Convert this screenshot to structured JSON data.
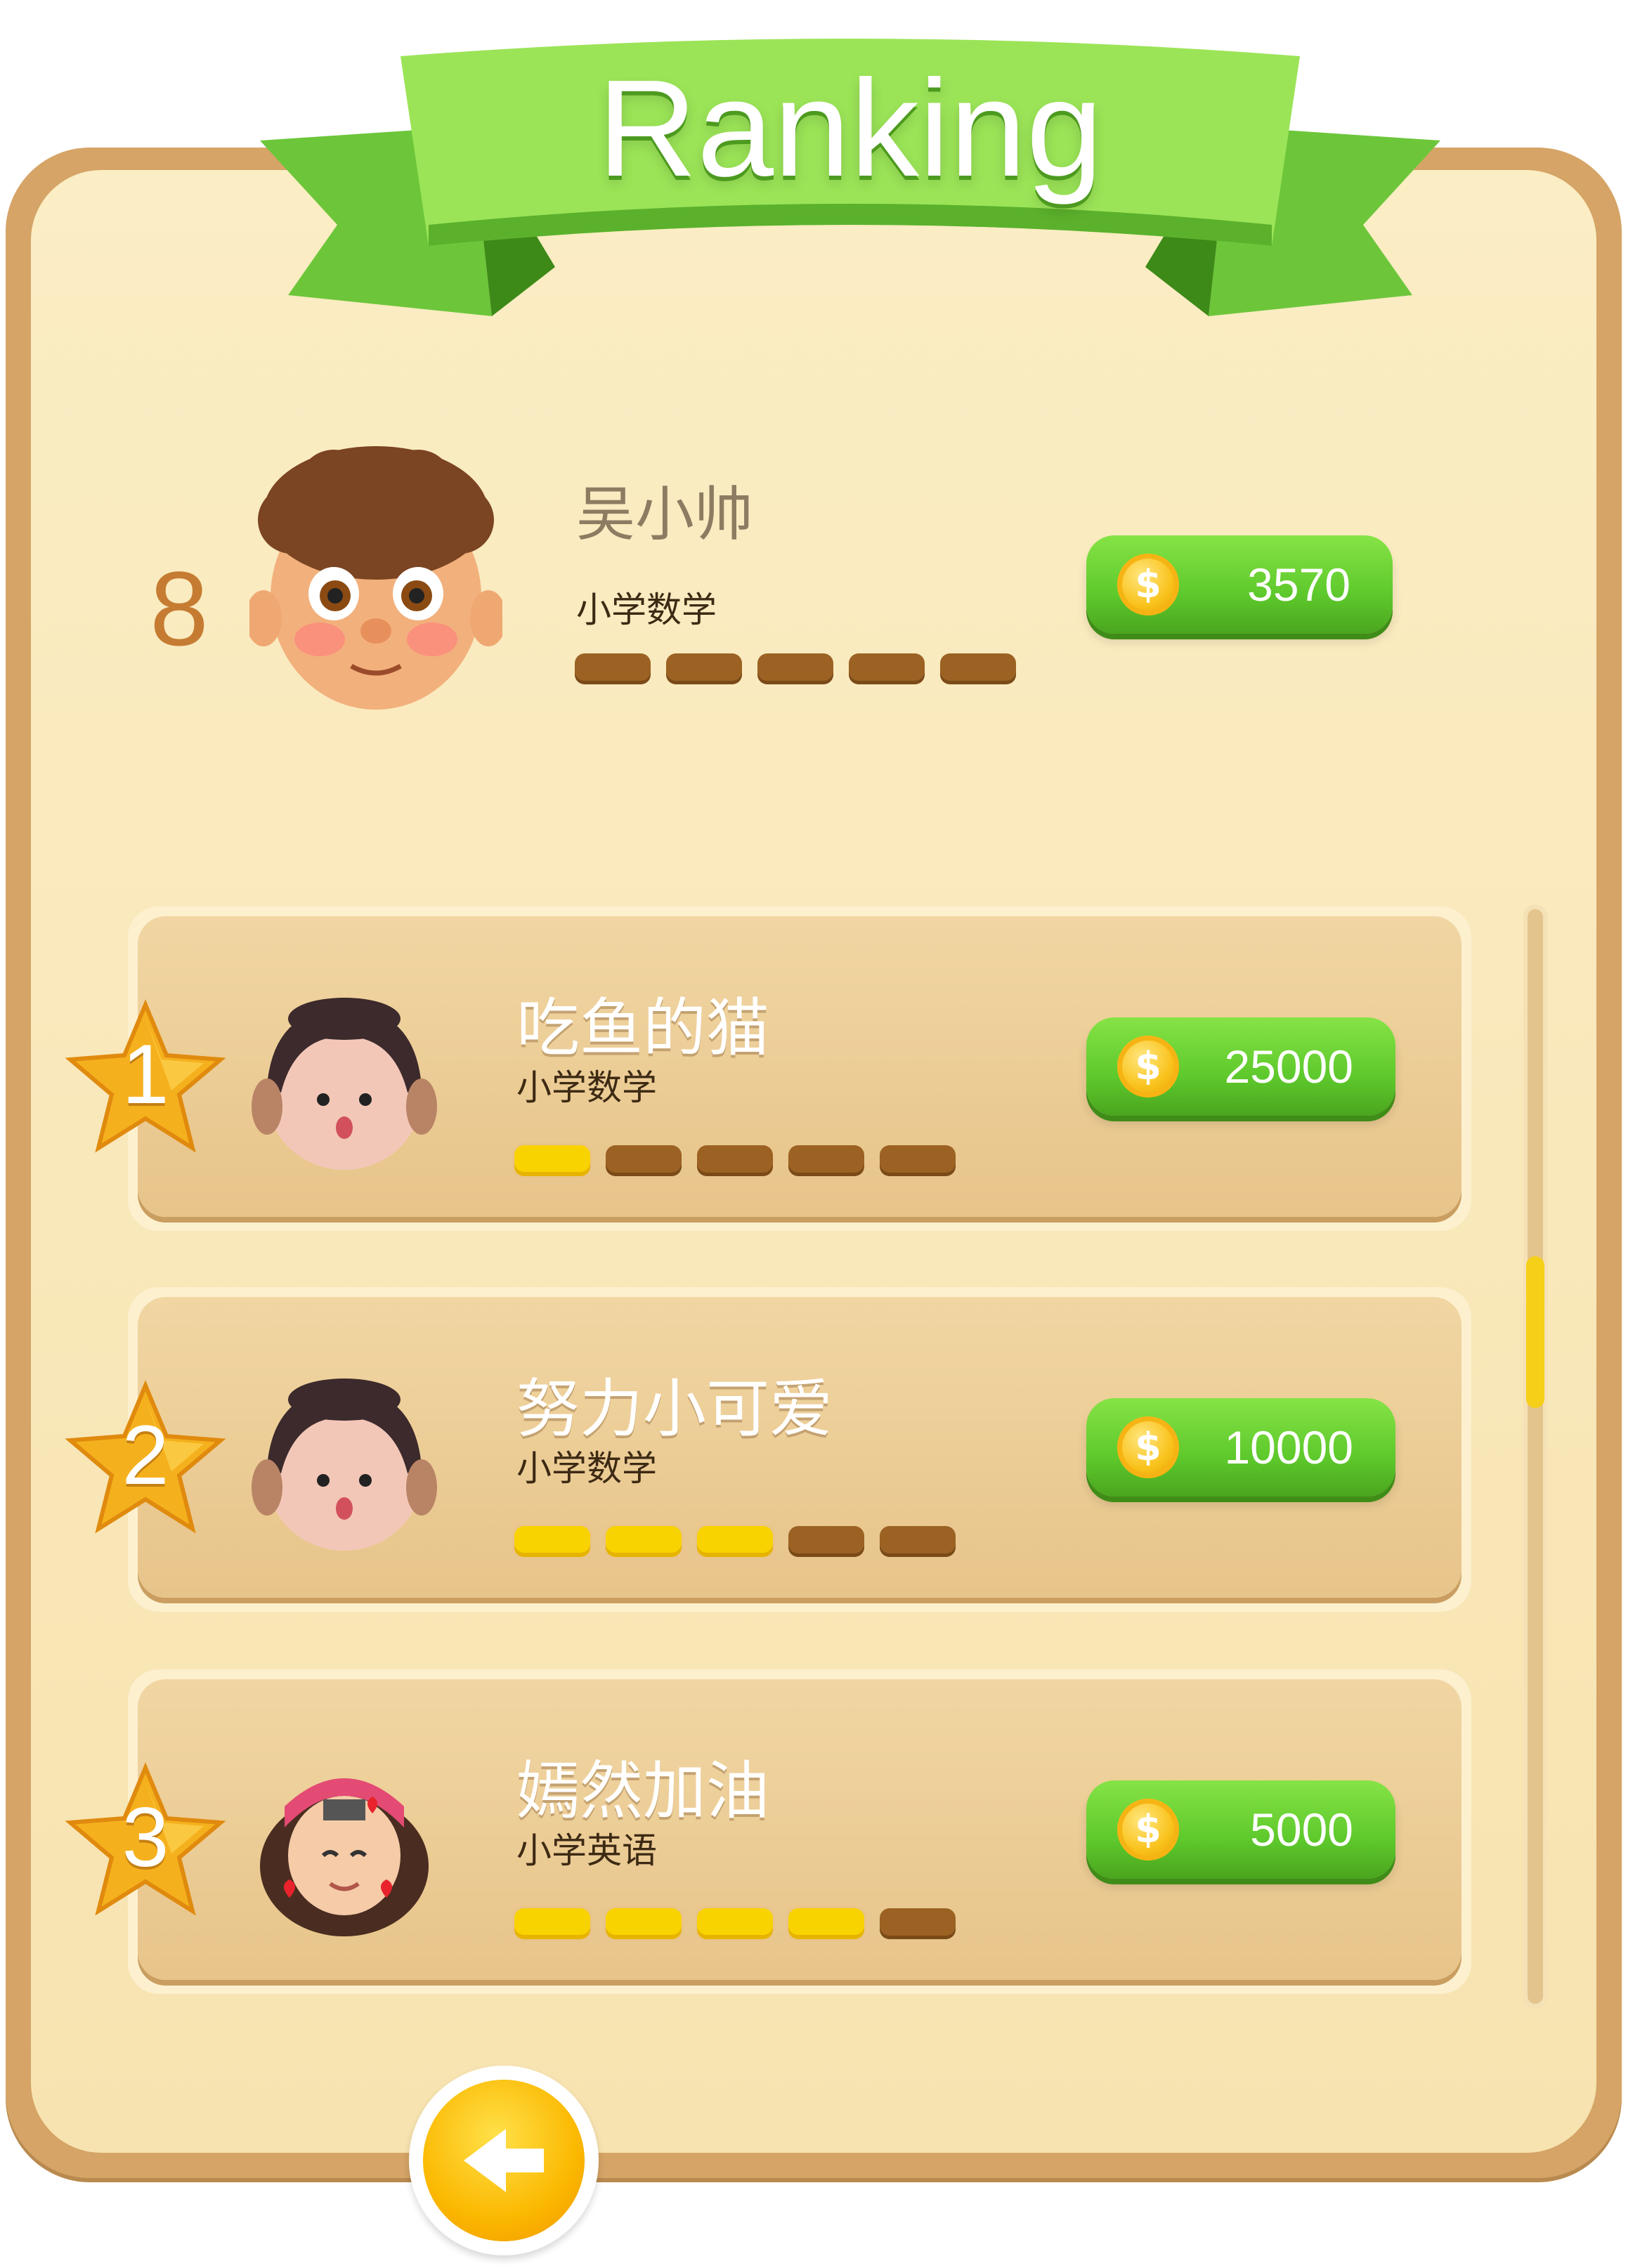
{
  "title": "Ranking",
  "me": {
    "rank": "8",
    "name": "吴小帅",
    "subject": "小学数学",
    "coins": "3570",
    "progress": 0
  },
  "list": [
    {
      "rank": "1",
      "name": "吃鱼的猫",
      "subject": "小学数学",
      "coins": "25000",
      "progress": 1
    },
    {
      "rank": "2",
      "name": "努力小可爱",
      "subject": "小学数学",
      "coins": "10000",
      "progress": 3
    },
    {
      "rank": "3",
      "name": "嫣然加油",
      "subject": "小学英语",
      "coins": "5000",
      "progress": 4
    }
  ],
  "progress_total": 5,
  "coin_symbol": "$",
  "colors": {
    "banner_green": "#7fd94a",
    "coin_button": "#5ec92c",
    "board": "#f8e6b7",
    "frame": "#d5a466"
  }
}
